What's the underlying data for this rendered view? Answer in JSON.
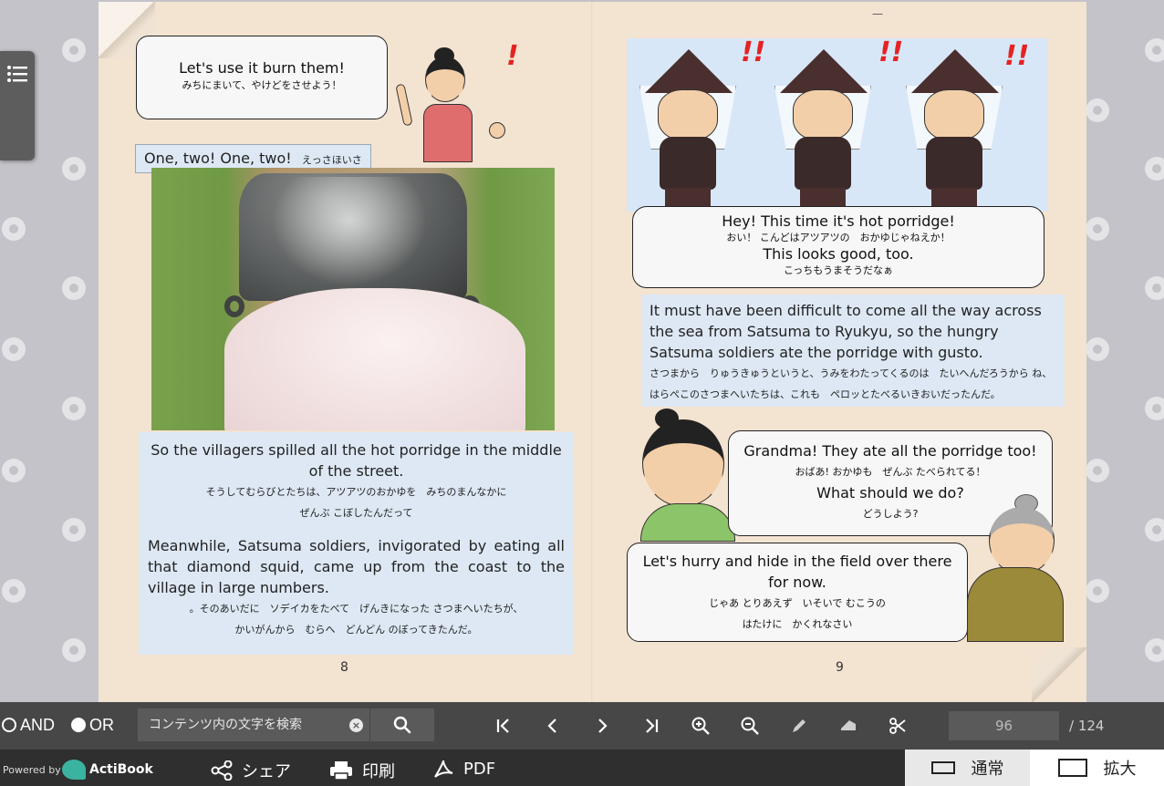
{
  "viewer": {
    "watermark": "ActiBook"
  },
  "menu": {
    "icon": "list-menu-icon"
  },
  "left_page": {
    "bubble_burn": {
      "en": "Let's use it burn them!",
      "jp": "みちにまいて、やけどをさせよう！"
    },
    "tag_onetwo": {
      "en": "One, two! One, two!",
      "jp": "えっさほいさ"
    },
    "narration1": {
      "en": "So the villagers spilled all the hot porridge in the middle of the street.",
      "jp1": "そうしてむらびとたちは、アツアツのおかゆを　みちのまんなかに",
      "jp2": "ぜんぶ こぼしたんだって"
    },
    "narration2": {
      "en": "Meanwhile, Satsuma soldiers, invigorated by eating all that diamond squid, came up from the coast to the village in large numbers.",
      "jp1": "。そのあいだに　ソデイカをたべて　げんきになった さつまへいたちが、",
      "jp2": "かいがんから　むらへ　どんどん のぼってきたんだ。"
    },
    "page_number": "8"
  },
  "right_page": {
    "header_mark": "—",
    "bubble_soldiers": {
      "en1": "Hey! This time it's hot porridge!",
      "jp1": "おい！ こんどはアツアツの　おかゆじゃねえか！",
      "en2": "This looks good, too.",
      "jp2": "こっちもうまそうだなぁ"
    },
    "narration": {
      "en": "It must have been difficult to come all the way across the sea from Satsuma to Ryukyu, so the hungry Satsuma soldiers ate the porridge with gusto.",
      "jp": "さつまから　りゅうきゅうというと、うみをわたってくるのは　たいへんだろうから ね、はらぺこのさつまへいたちは、これも　ペロッとたべるいきおいだったんだ。"
    },
    "bubble_grandma": {
      "en1": "Grandma! They ate all the porridge too!",
      "jp1": "おばあ! おかゆも　ぜんぶ たべられてる！",
      "en2": "What should we do?",
      "jp2": "どうしよう?"
    },
    "bubble_hide": {
      "en": "Let's hurry and hide in the field over there for now.",
      "jp1": "じゃあ とりあえず　いそいで むこうの",
      "jp2": "はたけに　かくれなさい"
    },
    "page_number": "9"
  },
  "toolbar": {
    "and_label": "AND",
    "or_label": "OR",
    "search_placeholder": "コンテンツ内の文字を検索",
    "clear_icon": "clear-icon",
    "search_icon": "search-icon",
    "current_page": "96",
    "total_pages": "/ 124",
    "accent": "#474747"
  },
  "bottombar": {
    "powered_by": "Powered by",
    "brand": "ActiBook",
    "share_label": "シェア",
    "print_label": "印刷",
    "pdf_label": "PDF",
    "mode_normal": "通常",
    "mode_zoom": "拡大"
  }
}
